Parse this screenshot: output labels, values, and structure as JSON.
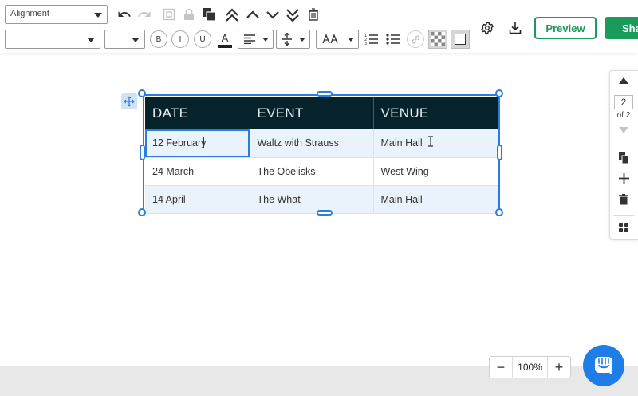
{
  "toolbar": {
    "alignment_select": "Alignment",
    "font_family_select": "",
    "font_size_select": "",
    "bold_label": "B",
    "italic_label": "I",
    "underline_label": "U",
    "font_color_label": "A",
    "preview_label": "Preview",
    "share_label": "Sha"
  },
  "table": {
    "headers": [
      "DATE",
      "EVENT",
      "VENUE"
    ],
    "rows": [
      [
        "12 February",
        "Waltz with Strauss",
        "Main Hall"
      ],
      [
        "24 March",
        "The Obelisks",
        "West Wing"
      ],
      [
        "14 April",
        "The What",
        "Main Hall"
      ]
    ]
  },
  "page_panel": {
    "current_page": "2",
    "of_text": "of 2"
  },
  "zoom": {
    "minus": "−",
    "value": "100%",
    "plus": "+"
  },
  "colors": {
    "accent": "#2b7de0",
    "header_bg": "#06222a",
    "brand_green": "#1a9b5b",
    "chat_fab": "#1f7de8"
  }
}
